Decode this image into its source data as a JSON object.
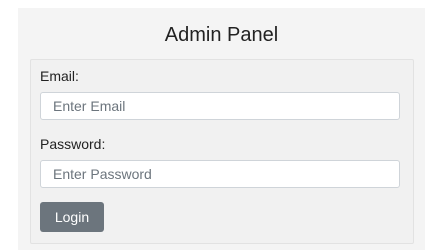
{
  "title": "Admin Panel",
  "form": {
    "email_label": "Email:",
    "email_placeholder": "Enter Email",
    "email_value": "",
    "password_label": "Password:",
    "password_placeholder": "Enter Password",
    "password_value": "",
    "login_label": "Login"
  },
  "colors": {
    "button": "#6c757d",
    "panel": "#f4f4f4"
  }
}
